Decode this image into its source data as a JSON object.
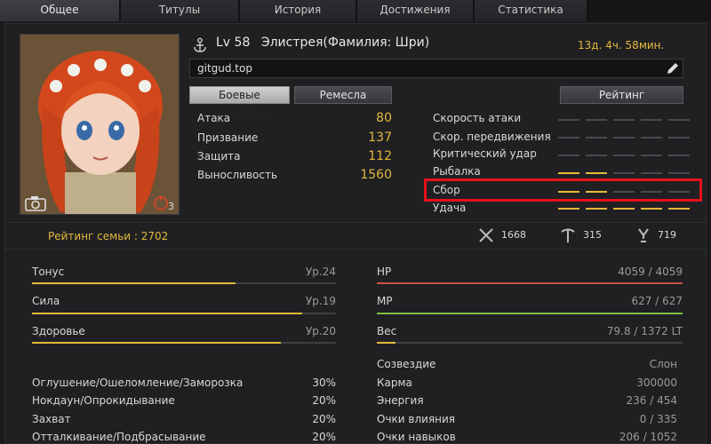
{
  "tabs": [
    {
      "label": "Общее",
      "active": true
    },
    {
      "label": "Титулы",
      "active": false
    },
    {
      "label": "История",
      "active": false
    },
    {
      "label": "Достижения",
      "active": false
    },
    {
      "label": "Статистика",
      "active": false
    }
  ],
  "header": {
    "level": "Lv 58",
    "name": "Элистрея(Фамилия: Шри)",
    "time": "13д. 4ч. 58мин.",
    "message": "gitgud.top"
  },
  "portrait": {
    "badge_count": "3"
  },
  "buttons": {
    "combat": "Боевые характери..",
    "crafts": "Ремесла",
    "rating": "Рейтинг"
  },
  "combat_stats": [
    {
      "label": "Атака",
      "value": "80"
    },
    {
      "label": "Призвание",
      "value": "137"
    },
    {
      "label": "Защита",
      "value": "112"
    },
    {
      "label": "Выносливость",
      "value": "1560"
    }
  ],
  "life_skills": [
    {
      "label": "Скорость атаки",
      "filled": 0
    },
    {
      "label": "Скор. передвижения",
      "filled": 0
    },
    {
      "label": "Критический удар",
      "filled": 0
    },
    {
      "label": "Рыбалка",
      "filled": 2
    },
    {
      "label": "Сбор",
      "filled": 2
    },
    {
      "label": "Удача",
      "filled": 5
    }
  ],
  "family": {
    "rating": "Рейтинг семьи : 2702"
  },
  "totals": {
    "combat": "1668",
    "life": "315",
    "skill": "719"
  },
  "personal": [
    {
      "label": "Тонус",
      "level": "Ур.24",
      "fill": 0.67
    },
    {
      "label": "Сила",
      "level": "Ур.19",
      "fill": 0.89
    },
    {
      "label": "Здоровье",
      "level": "Ур.20",
      "fill": 0.82
    }
  ],
  "resources": [
    {
      "label": "HP",
      "value": "4059 / 4059",
      "fill": 1.0,
      "color": "#c8563f"
    },
    {
      "label": "MP",
      "value": "627 / 627",
      "fill": 1.0,
      "color": "#7fbf3f"
    },
    {
      "label": "Вес",
      "value": "79.8 / 1372 LT",
      "fill": 0.06,
      "color": "#e2b93b"
    }
  ],
  "cc_resist": [
    {
      "label": "Оглушение/Ошеломление/Заморозка",
      "value": "30%"
    },
    {
      "label": "Нокдаун/Опрокидывание",
      "value": "20%"
    },
    {
      "label": "Захват",
      "value": "20%"
    },
    {
      "label": "Отталкивание/Подбрасывание",
      "value": "20%"
    }
  ],
  "info": [
    {
      "label": "Созвездие",
      "value": "Слон"
    },
    {
      "label": "Карма",
      "value": "300000"
    },
    {
      "label": "Энергия",
      "value": "236 / 454"
    },
    {
      "label": "Очки влияния",
      "value": "0 / 335"
    },
    {
      "label": "Очки навыков",
      "value": "206 / 1052"
    }
  ],
  "colors": {
    "accent": "#e2b93b",
    "highlight": "#e8101a"
  }
}
